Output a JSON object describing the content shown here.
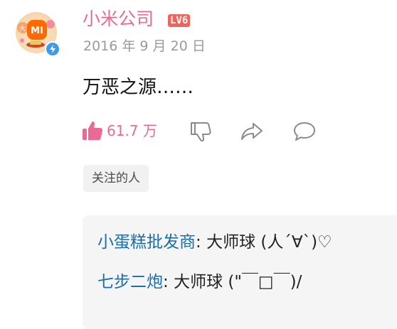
{
  "post": {
    "username": "小米公司",
    "level_badge": "LV6",
    "timestamp": "2016 年 9 月 20 日",
    "content": "万恶之源……",
    "likes": "61.7 万",
    "tag": "关注的人"
  },
  "replies": [
    {
      "name": "小蛋糕批发商",
      "sep": ": ",
      "text": "大师球 (人´∀`)♡"
    },
    {
      "name": "七步二炮",
      "sep": ": ",
      "text": "大师球 (\"￣□￣)/"
    },
    {
      "name": "",
      "sep": "",
      "text": ""
    }
  ],
  "colors": {
    "username": "#ea6a96",
    "like_accent": "#ea6a96",
    "level_badge_bg": "#f0645a",
    "reply_name": "#1b6ea8",
    "timestamp": "#9a9a9a",
    "icon_gray": "#8a8a8a",
    "verified_badge": "#3d9be9"
  },
  "icons": {
    "avatar_logo_text": "MI",
    "verified": "lightning-bolt"
  }
}
